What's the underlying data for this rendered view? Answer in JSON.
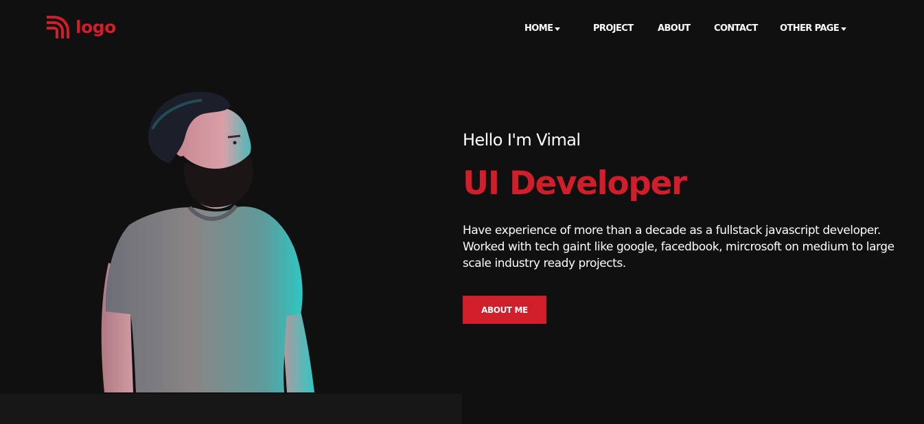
{
  "colors": {
    "background": "#101010",
    "accent": "#d01e2a",
    "text": "#ffffff",
    "panel": "#171717"
  },
  "header": {
    "logo": {
      "icon": "rss-signal-icon",
      "text": "logo"
    },
    "nav": [
      {
        "label": "HOME",
        "has_dropdown": true
      },
      {
        "label": "PROJECT",
        "has_dropdown": false
      },
      {
        "label": "ABOUT",
        "has_dropdown": false
      },
      {
        "label": "CONTACT",
        "has_dropdown": false
      },
      {
        "label": "OTHER PAGE",
        "has_dropdown": true
      }
    ]
  },
  "hero": {
    "image": "portrait-man-bearded",
    "greeting": "Hello I'm Vimal",
    "role": "UI Developer",
    "bio": "Have experience of more than a decade as a fullstack javascript developer. Worked with tech gaint like google, facedbook, mircrosoft on medium to large scale industry ready projects.",
    "cta_label": "ABOUT ME"
  }
}
